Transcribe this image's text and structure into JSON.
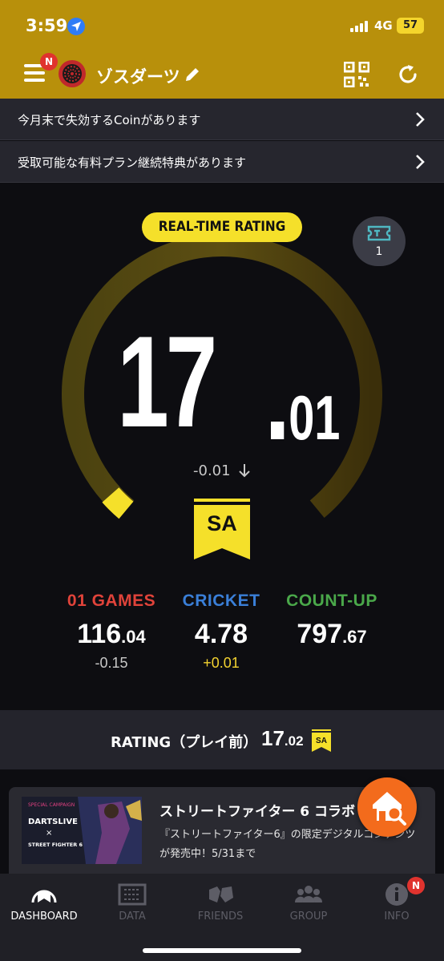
{
  "status_bar": {
    "time": "3:59",
    "network": "4G",
    "battery": "57"
  },
  "header": {
    "menu_badge": "N",
    "username": "ゾスダーツ"
  },
  "notices": [
    {
      "label": "今月末で失効するCoinがあります"
    },
    {
      "label": "受取可能な有料プラン継続特典があります"
    }
  ],
  "rating": {
    "pill_label": "REAL-TIME RATING",
    "ticket_count": "1",
    "integer": "17",
    "decimal": "01",
    "change": "-0.01",
    "class": "SA"
  },
  "stats": [
    {
      "label": "01 GAMES",
      "value_int": "116",
      "value_dec": ".04",
      "change": "-0.15",
      "color": "#e0433a",
      "change_color": "#c8c8c8"
    },
    {
      "label": "CRICKET",
      "value_int": "4.78",
      "value_dec": "",
      "change": "+0.01",
      "color": "#3a7fd8",
      "change_color": "#f2d230"
    },
    {
      "label": "COUNT-UP",
      "value_int": "797",
      "value_dec": ".67",
      "change": "",
      "color": "#4aa84a",
      "change_color": "#c8c8c8"
    }
  ],
  "previous_rating": {
    "label": "RATING（プレイ前）",
    "value_int": "17",
    "value_dec": ".02",
    "class": "SA"
  },
  "campaign": {
    "title": "ストリートファイター 6 コラボ",
    "body": "『ストリートファイター6』の限定デジタルコンテンツが発売中！5/31まで",
    "thumb_top": "SPECIAL CAMPAIGN",
    "thumb_brand": "DARTSLIVE",
    "thumb_x": "×",
    "thumb_game": "STREET FIGHTER 6"
  },
  "bottom_nav": [
    {
      "label": "DASHBOARD",
      "icon": "dashboard-icon",
      "active": true
    },
    {
      "label": "DATA",
      "icon": "data-icon",
      "active": false
    },
    {
      "label": "FRIENDS",
      "icon": "friends-icon",
      "active": false
    },
    {
      "label": "GROUP",
      "icon": "group-icon",
      "active": false
    },
    {
      "label": "INFO",
      "icon": "info-icon",
      "active": false
    }
  ],
  "info_badge": "N",
  "colors": {
    "header": "#b8900b",
    "accent": "#f5e02a",
    "background": "#0d0d11"
  },
  "gauge": {
    "level": 0.01
  }
}
